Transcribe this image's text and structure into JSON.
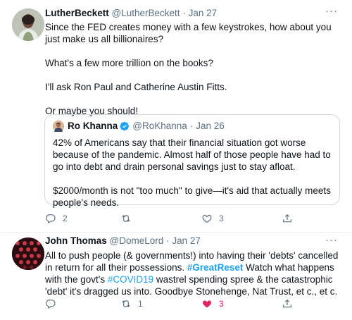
{
  "tweets": [
    {
      "display_name": "LutherBeckett",
      "handle": "@LutherBeckett",
      "separator": "·",
      "time": "Jan 27",
      "more": "···",
      "paragraphs": [
        "Since the FED creates money with a few keystrokes, how about you just make us all billionaires?",
        "What's a few more trillion on the books?",
        "I'll ask Ron Paul and Catherine Austin Fitts.",
        "Or maybe you should!"
      ],
      "quoted": {
        "display_name": "Ro Khanna",
        "handle": "@RoKhanna",
        "separator": "·",
        "time": "Jan 26",
        "paragraphs": [
          "42% of Americans say that their financial situation got worse because of the pandemic. Almost half of those people have had to go into debt and drain personal savings just to stay afloat.",
          "$2000/month is not \"too much\" to give—it's aid that actually meets people's needs."
        ]
      },
      "actions": {
        "replies": "2",
        "retweets": "",
        "likes": "3",
        "liked": false
      }
    },
    {
      "display_name": "John Thomas",
      "handle": "@DomeLord",
      "separator": "·",
      "time": "Jan 27",
      "more": "···",
      "text_parts": {
        "a": "All to push people (& governments!) into having their 'debts' cancelled in return for all their possessions. ",
        "hashtag1": "#GreatReset",
        "b": " Watch what happens with the govt's ",
        "hashtag2": "#COVID19",
        "c": " wastrel spending spree & the catastrophic 'debt' it's dragged us into. Goodbye Stonehenge, Nat Trust, et c., et c."
      },
      "actions": {
        "replies": "",
        "retweets": "1",
        "likes": "3",
        "liked": true
      }
    }
  ],
  "colors": {
    "link": "#1da1f2",
    "muted": "#5b7083",
    "like": "#e0245e",
    "verified": "#1da1f2",
    "border": "#cfd9de"
  }
}
